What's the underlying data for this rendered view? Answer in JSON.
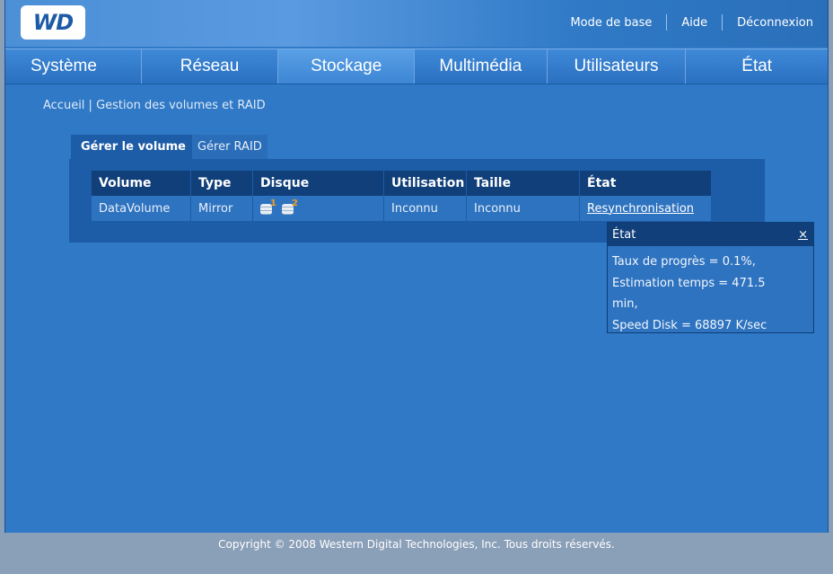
{
  "header": {
    "logo_text": "WD",
    "links": [
      "Mode de base",
      "Aide",
      "Déconnexion"
    ]
  },
  "nav": {
    "tabs": [
      "Système",
      "Réseau",
      "Stockage",
      "Multimédia",
      "Utilisateurs",
      "État"
    ],
    "active": "Stockage"
  },
  "breadcrumb": "Accueil | Gestion des volumes et RAID",
  "subtabs": [
    "Gérer le volume",
    "Gérer RAID"
  ],
  "table": {
    "headers": [
      "Volume",
      "Type",
      "Disque",
      "Utilisation",
      "Taille",
      "État"
    ],
    "rows": [
      {
        "volume": "DataVolume",
        "type": "Mirror",
        "disks": [
          "1",
          "2"
        ],
        "usage": "Inconnu",
        "size": "Inconnu",
        "status": "Resynchronisation"
      }
    ]
  },
  "popup": {
    "title": "État",
    "close": "×",
    "lines": [
      "Taux de progrès = 0.1%,",
      "Estimation temps = 471.5",
      "min,",
      "Speed Disk = 68897 K/sec"
    ]
  },
  "footer": "Copyright © 2008 Western Digital Technologies, Inc. Tous droits réservés.",
  "icons": {
    "disk": "disk-stack-icon"
  }
}
